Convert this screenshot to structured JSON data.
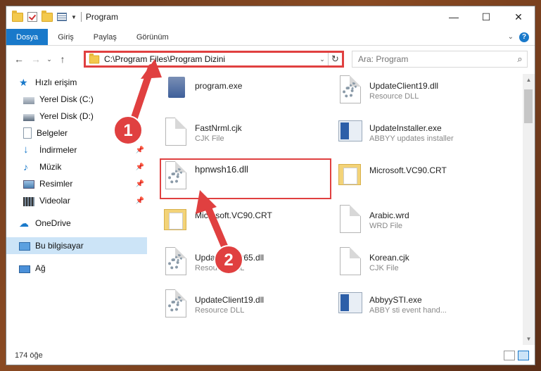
{
  "window": {
    "title": "Program"
  },
  "ribbon": {
    "tabs": [
      "Dosya",
      "Giriş",
      "Paylaş",
      "Görünüm"
    ]
  },
  "address": {
    "path": "C:\\Program Files\\Program Dizini"
  },
  "search": {
    "placeholder": "Ara: Program"
  },
  "sidebar": {
    "items": [
      {
        "label": "Hızlı erişim",
        "icon": "star-icon"
      },
      {
        "label": "Yerel Disk (C:)",
        "icon": "drive-icon"
      },
      {
        "label": "Yerel Disk (D:)",
        "icon": "drive-icon"
      },
      {
        "label": "Belgeler",
        "icon": "documents-icon"
      },
      {
        "label": "İndirmeler",
        "icon": "download-icon"
      },
      {
        "label": "Müzik",
        "icon": "music-icon"
      },
      {
        "label": "Resimler",
        "icon": "pictures-icon"
      },
      {
        "label": "Videolar",
        "icon": "video-icon"
      },
      {
        "label": "OneDrive",
        "icon": "cloud-icon"
      },
      {
        "label": "Bu bilgisayar",
        "icon": "computer-icon"
      },
      {
        "label": "Ağ",
        "icon": "network-icon"
      }
    ]
  },
  "files": [
    {
      "name": "program.exe",
      "type": "",
      "icon": "exe-icon"
    },
    {
      "name": "UpdateClient19.dll",
      "type": "Resource DLL",
      "icon": "dll-icon"
    },
    {
      "name": "FastNrml.cjk",
      "type": "CJK File",
      "icon": "file-icon"
    },
    {
      "name": "UpdateInstaller.exe",
      "type": "ABBYY updates installer",
      "icon": "app-icon"
    },
    {
      "name": "hpnwsh16.dll",
      "type": "",
      "icon": "dll-icon"
    },
    {
      "name": "Microsoft.VC90.CRT",
      "type": "",
      "icon": "folder-icon"
    },
    {
      "name": "Microsoft.VC90.CRT",
      "type": "",
      "icon": "folder-icon"
    },
    {
      "name": "Arabic.wrd",
      "type": "WRD File",
      "icon": "file-icon"
    },
    {
      "name": "UpdateClient65.dll",
      "type": "Resource DLL",
      "icon": "dll-icon"
    },
    {
      "name": "Korean.cjk",
      "type": "CJK File",
      "icon": "file-icon"
    },
    {
      "name": "UpdateClient19.dll",
      "type": "Resource DLL",
      "icon": "dll-icon"
    },
    {
      "name": "AbbyySTI.exe",
      "type": "ABBY sti event hand...",
      "icon": "app-icon"
    }
  ],
  "status": {
    "count": "174 öğe"
  },
  "annotations": {
    "one": "1",
    "two": "2"
  },
  "colors": {
    "accent": "#1979ca",
    "highlight": "#e04040"
  }
}
